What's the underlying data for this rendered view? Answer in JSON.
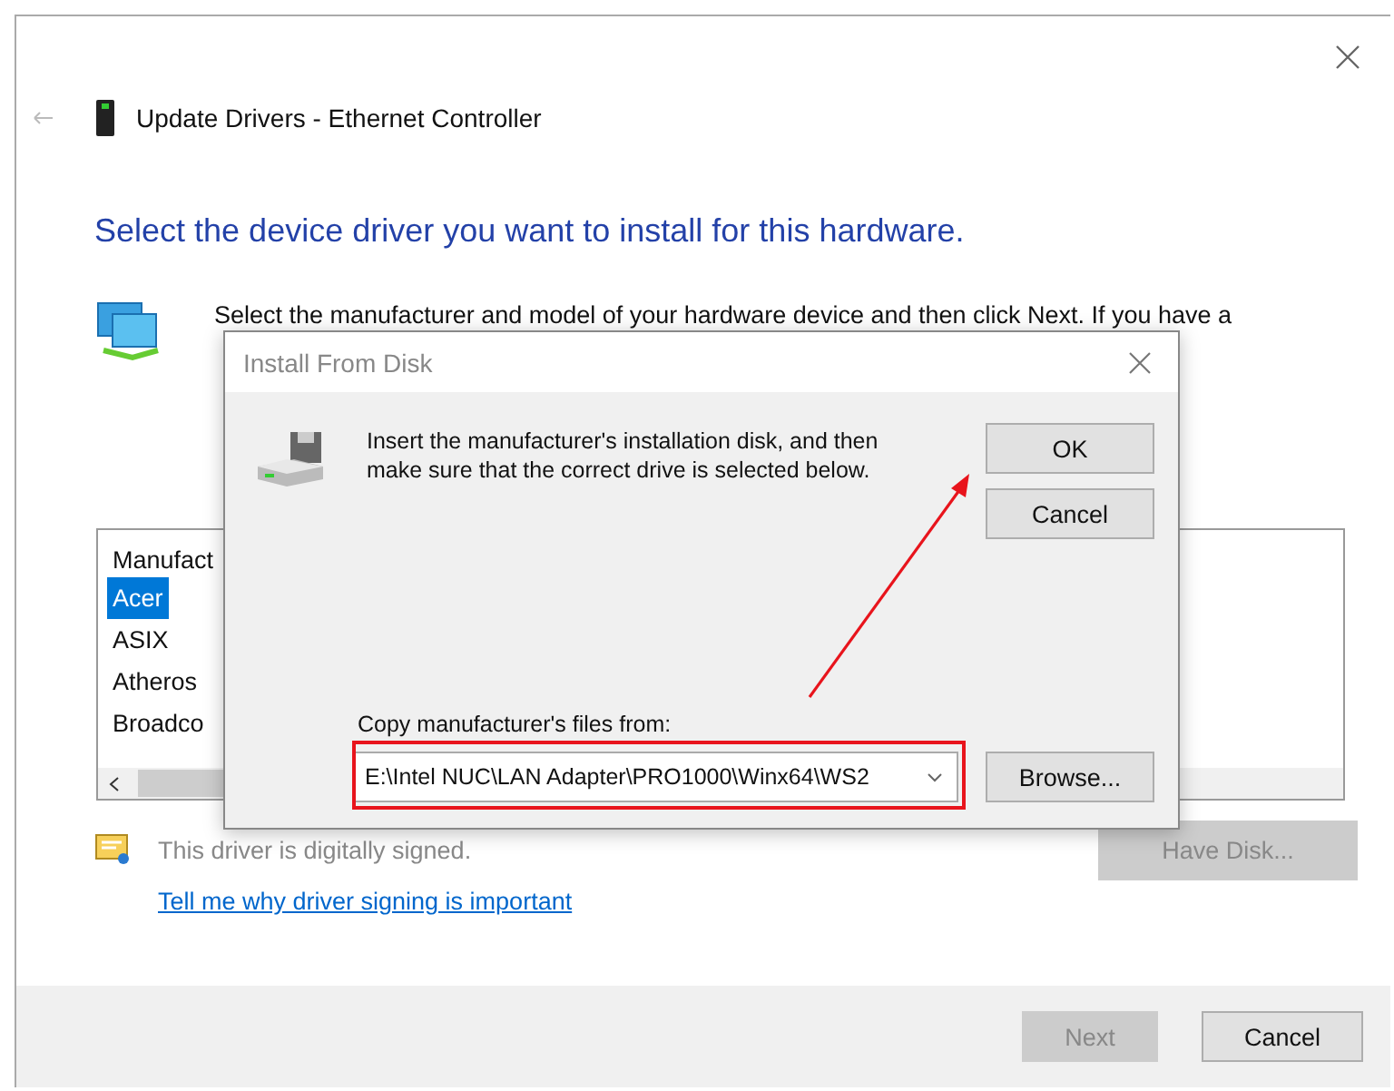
{
  "window": {
    "title": "Update Drivers - Ethernet Controller",
    "heading": "Select the device driver you want to install for this hardware.",
    "instructions": "Select the manufacturer and model of your hardware device and then click Next. If you have a",
    "manufacturer_list": {
      "header": "Manufact",
      "items": [
        {
          "label": "Acer",
          "selected": true
        },
        {
          "label": "ASIX",
          "selected": false
        },
        {
          "label": "Atheros",
          "selected": false
        },
        {
          "label": "Broadco",
          "selected": false
        }
      ]
    },
    "signature": {
      "text": "This driver is digitally signed.",
      "link": "Tell me why driver signing is important"
    },
    "have_disk_button": {
      "label": "Have Disk...",
      "disabled": true
    },
    "footer_buttons": [
      {
        "label": "Next",
        "disabled": true
      },
      {
        "label": "Cancel",
        "disabled": false
      }
    ]
  },
  "dialog": {
    "title": "Install From Disk",
    "message": "Insert the manufacturer's installation disk, and then make sure that the correct drive is selected below.",
    "buttons": [
      {
        "label": "OK"
      },
      {
        "label": "Cancel"
      }
    ],
    "source_label": "Copy manufacturer's files from:",
    "source_value": "E:\\Intel NUC\\LAN Adapter\\PRO1000\\Winx64\\WS2",
    "browse_button": "Browse..."
  }
}
